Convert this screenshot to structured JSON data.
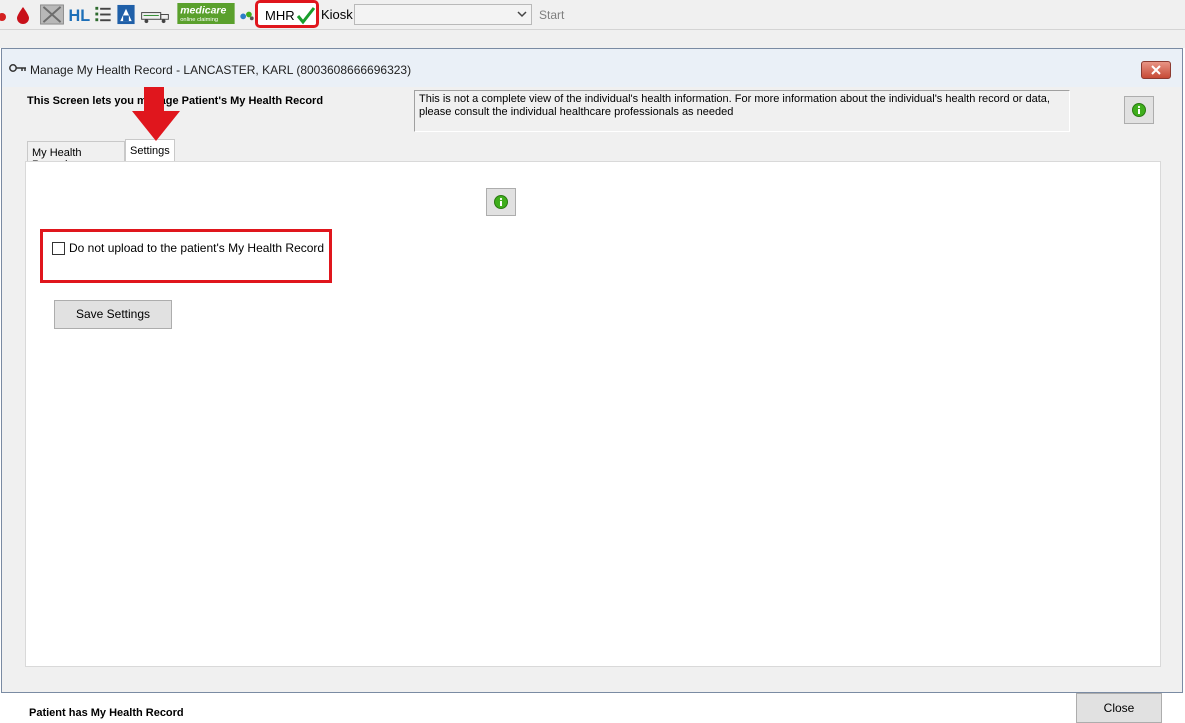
{
  "toolbar": {
    "icons": [
      "red-circle-icon",
      "blood-drop-icon",
      "grey-x-icon",
      "hl-icon",
      "list-icon",
      "shield-icon",
      "truck-icon",
      "medicare-logo-icon",
      "pills-icon"
    ],
    "medicare_logo_text": "medicare",
    "medicare_logo_subtext": "online claiming",
    "mhr_label": "MHR",
    "kiosk_label": "Kiosk",
    "kiosk_selected": "",
    "start_label": "Start"
  },
  "window": {
    "title": "Manage My Health Record - LANCASTER, KARL (8003608666696323)",
    "intro_text": "This Screen lets you manage Patient's My Health Record",
    "disclaimer": "This is not a complete view of the individual's health information. For more information about the individual's health record or data, please consult the individual healthcare professionals as needed",
    "tabs": [
      {
        "label": "My Health Record",
        "active": false
      },
      {
        "label": "Settings",
        "active": true
      }
    ],
    "settings": {
      "checkbox_label": "Do not upload to the patient's My Health Record",
      "checkbox_checked": false,
      "save_button": "Save Settings"
    },
    "status_text": "Patient has My Health Record",
    "close_button": "Close"
  },
  "colors": {
    "highlight_red": "#e0161d",
    "info_green": "#3fae1c",
    "check_green": "#1a9e2c",
    "medicare_green": "#5aa02c"
  }
}
